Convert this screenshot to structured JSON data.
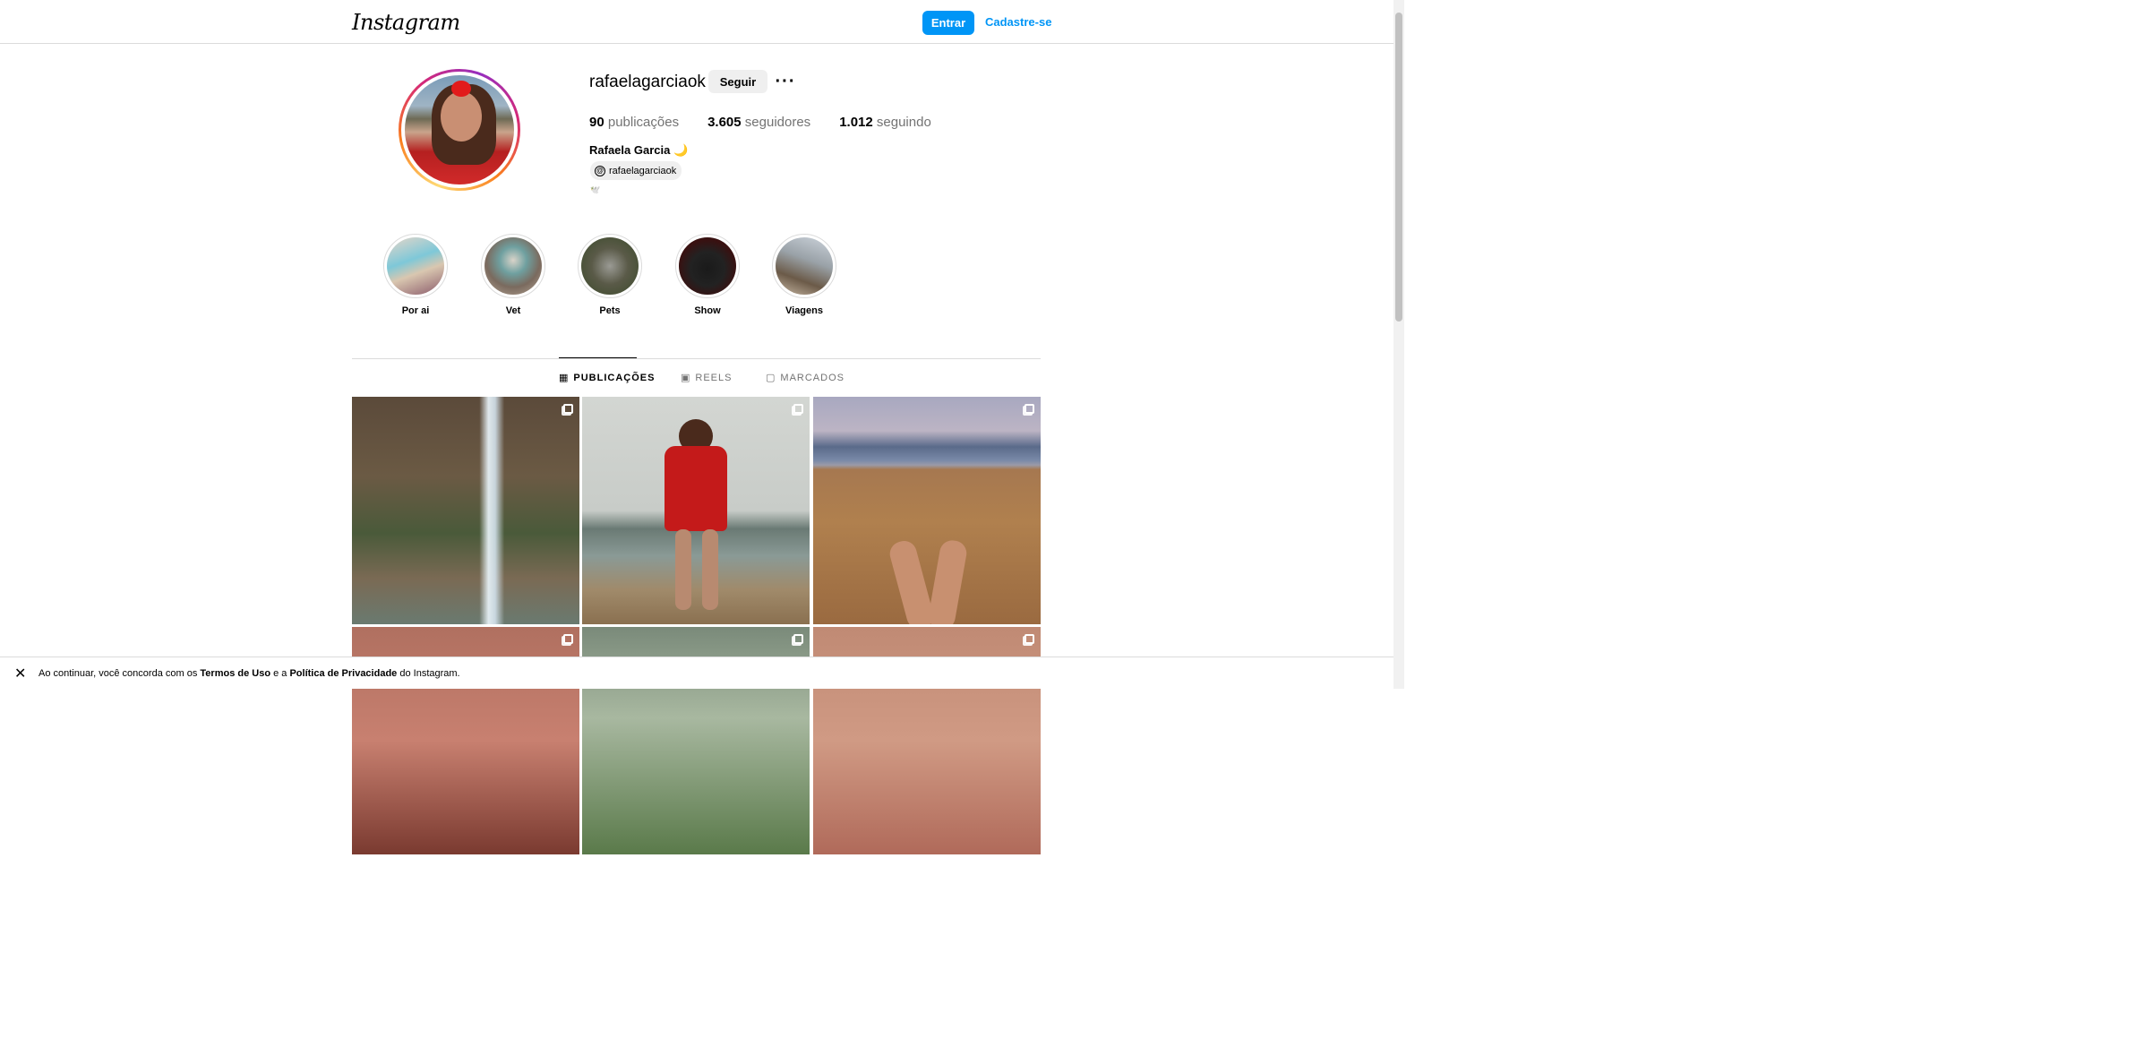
{
  "header": {
    "logo_text": "Instagram",
    "login_label": "Entrar",
    "signup_label": "Cadastre-se"
  },
  "profile": {
    "username": "rafaelagarciaok",
    "follow_label": "Seguir",
    "more_icon": "more-horizontal-icon",
    "stats": {
      "posts_count": "90",
      "posts_label": "publicações",
      "followers_count": "3.605",
      "followers_label": "seguidores",
      "following_count": "1.012",
      "following_label": "seguindo"
    },
    "full_name": "Rafaela Garcia 🌙",
    "threads_handle": "rafaelagarciaok",
    "bio_emoji": "🕊️"
  },
  "highlights": [
    {
      "label": "Por ai"
    },
    {
      "label": "Vet"
    },
    {
      "label": "Pets"
    },
    {
      "label": "Show"
    },
    {
      "label": "Viagens"
    }
  ],
  "tabs": [
    {
      "label": "PUBLICAÇÕES",
      "icon": "grid-icon",
      "active": true
    },
    {
      "label": "REELS",
      "icon": "reels-icon",
      "active": false
    },
    {
      "label": "MARCADOS",
      "icon": "tagged-icon",
      "active": false
    }
  ],
  "posts": [
    {
      "subject": "waterfall"
    },
    {
      "subject": "woman-red-outfit-beach"
    },
    {
      "subject": "beach-sand-legs"
    },
    {
      "subject": "face-close-up"
    },
    {
      "subject": "grass-close-up"
    },
    {
      "subject": "face-close-up-lips"
    }
  ],
  "footer": {
    "prefix": "Ao continuar, você concorda com os ",
    "terms_label": "Termos de Uso",
    "middle": " e a ",
    "privacy_label": "Política de Privacidade",
    "suffix": " do Instagram.",
    "close_icon": "close-icon"
  },
  "colors": {
    "accent": "#0095f6",
    "button_gray": "#efefef",
    "border": "#dbdbdb",
    "muted_text": "#737373"
  }
}
